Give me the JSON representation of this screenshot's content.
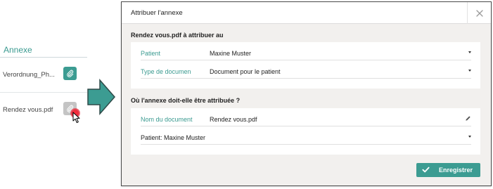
{
  "background": {
    "header_label": "Annexe",
    "rows": [
      {
        "name": "Verordnung_Ph..."
      },
      {
        "name": "Rendez vous.pdf"
      }
    ]
  },
  "modal": {
    "title": "Attribuer l'annexe",
    "section1_title": "Rendez vous.pdf à attribuer au",
    "patient_label": "Patient",
    "patient_value": "Maxine Muster",
    "doctype_label": "Type de documen",
    "doctype_value": "Document pour le patient",
    "section2_title": "Où l'annexe doit-elle être attribuée ?",
    "docname_label": "Nom du document",
    "docname_value": "Rendez vous.pdf",
    "target_value": "Patient: Maxine Muster",
    "save_label": "Enregistrer"
  },
  "colors": {
    "accent": "#3c9c92",
    "click_marker": "#e8303f"
  },
  "icons": [
    "paperclip-icon",
    "cursor-icon",
    "close-icon",
    "caret-down-icon",
    "pencil-icon",
    "check-icon",
    "arrow-right-icon"
  ]
}
